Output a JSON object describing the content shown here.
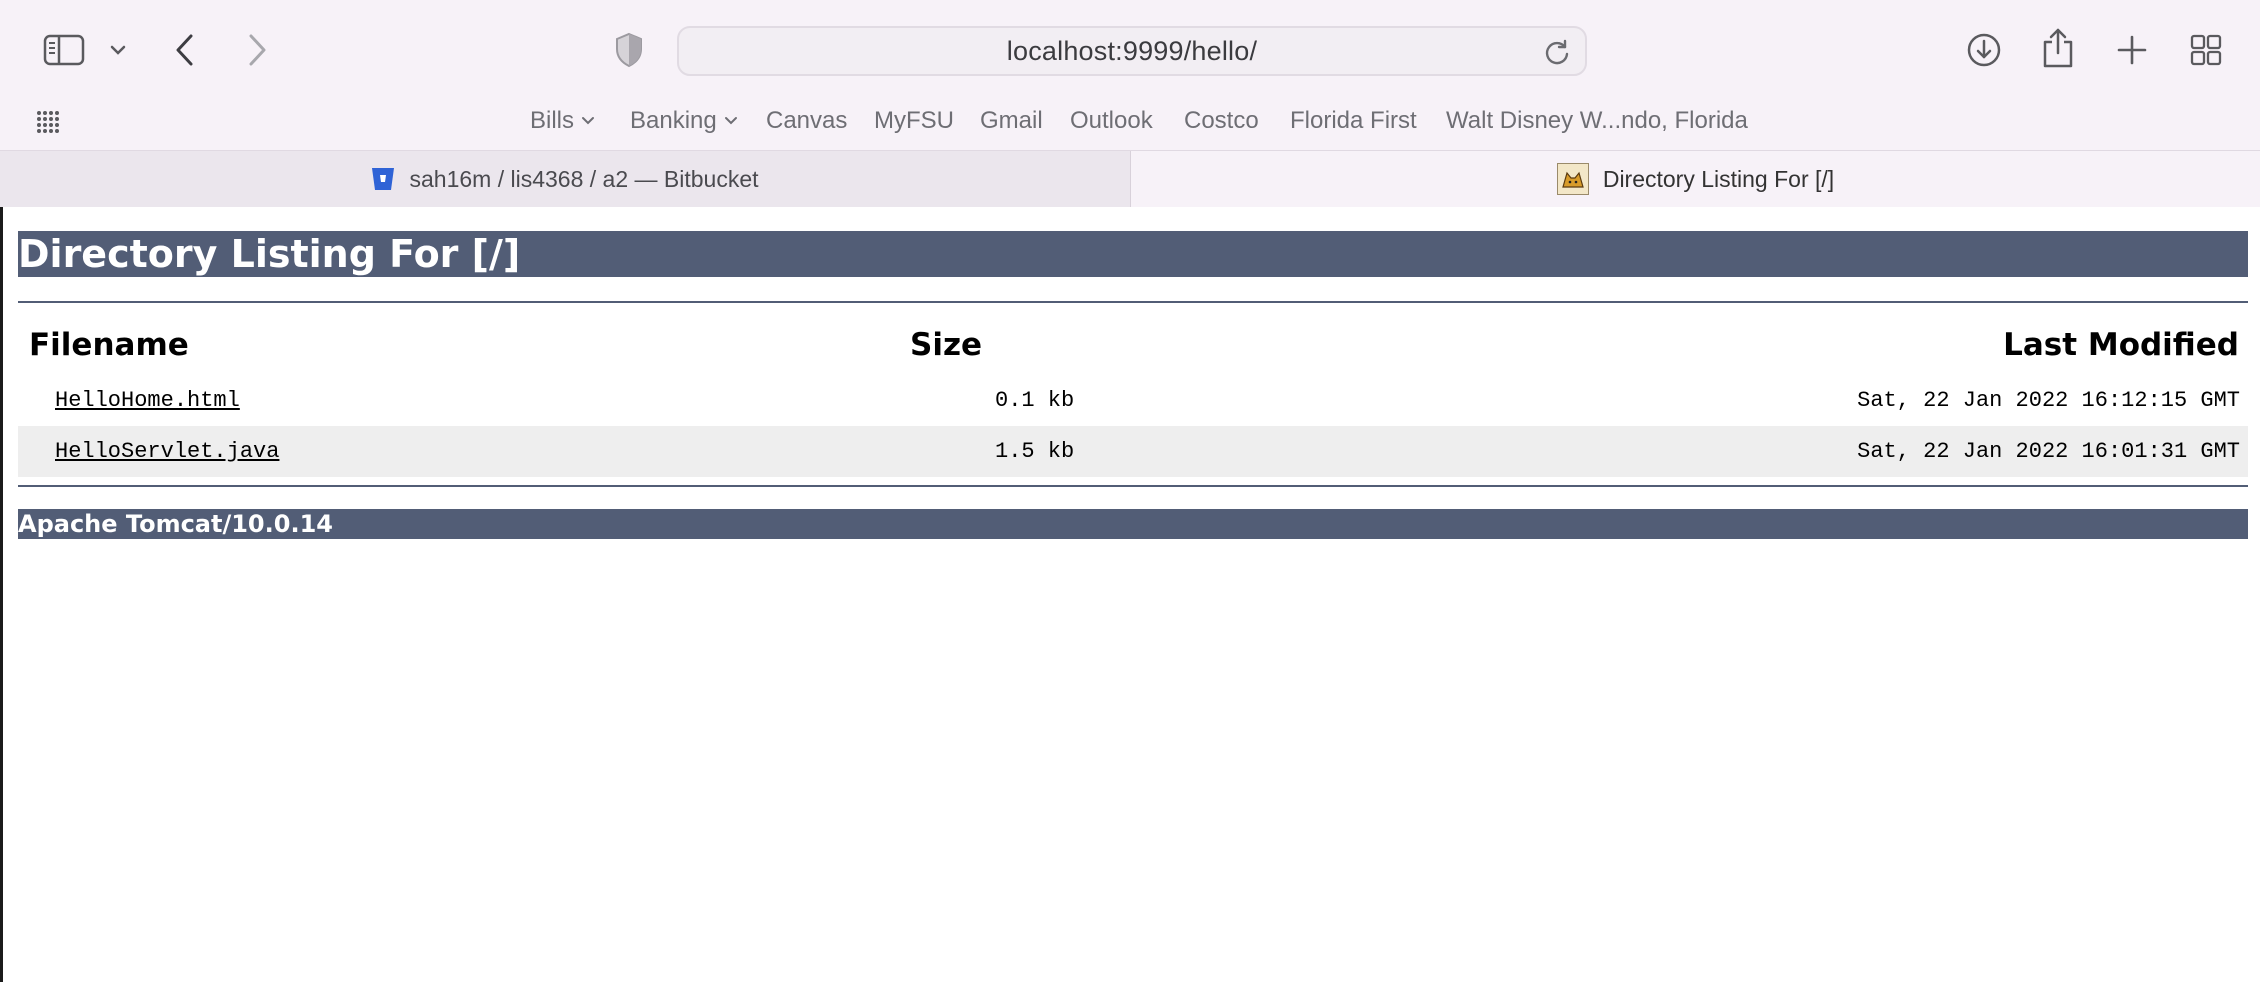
{
  "browser": {
    "url": "localhost:9999/hello/",
    "icons": {
      "sidebar": "sidebar-icon",
      "sidebar_menu": "chevron-down-icon",
      "back": "chevron-left-icon",
      "forward": "chevron-right-icon",
      "privacy": "shield-icon",
      "reload": "reload-icon",
      "downloads": "download-icon",
      "share": "share-icon",
      "new_tab": "plus-icon",
      "tab_overview": "grid-icon",
      "favorites_grid": "apps-grid-icon"
    }
  },
  "favorites": [
    {
      "label": "Bills",
      "menu": true
    },
    {
      "label": "Banking",
      "menu": true
    },
    {
      "label": "Canvas",
      "menu": false
    },
    {
      "label": "MyFSU",
      "menu": false
    },
    {
      "label": "Gmail",
      "menu": false
    },
    {
      "label": "Outlook",
      "menu": false
    },
    {
      "label": "Costco",
      "menu": false
    },
    {
      "label": "Florida First",
      "menu": false
    },
    {
      "label": "Walt Disney W...ndo, Florida",
      "menu": false
    }
  ],
  "tabs": [
    {
      "title": "sah16m / lis4368 / a2 — Bitbucket",
      "active": false
    },
    {
      "title": "Directory Listing For [/]",
      "active": true
    }
  ],
  "page": {
    "title": "Directory Listing For [/]",
    "columns": {
      "filename": "Filename",
      "size": "Size",
      "modified": "Last Modified"
    },
    "files": [
      {
        "name": "HelloHome.html",
        "size": "0.1 kb",
        "modified": "Sat, 22 Jan 2022 16:12:15 GMT"
      },
      {
        "name": "HelloServlet.java",
        "size": "1.5 kb",
        "modified": "Sat, 22 Jan 2022 16:01:31 GMT"
      }
    ],
    "footer": "Apache Tomcat/10.0.14"
  },
  "colors": {
    "banner": "#525d76",
    "chrome_background": "#f7f2f8",
    "row_alt": "#eeeeee",
    "bitbucket_blue": "#2f63d6"
  }
}
